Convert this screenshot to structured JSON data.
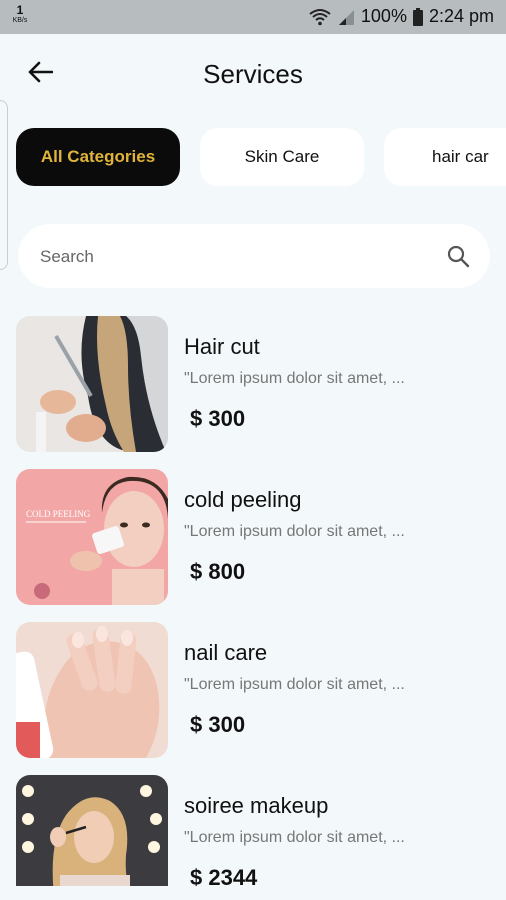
{
  "status_bar": {
    "kbs_value": "1",
    "kbs_unit": "KB/s",
    "battery": "100%",
    "time": "2:24 pm"
  },
  "header": {
    "title": "Services"
  },
  "categories": [
    {
      "label": "All Categories",
      "active": true
    },
    {
      "label": "Skin Care",
      "active": false
    },
    {
      "label": "hair car",
      "active": false
    }
  ],
  "search": {
    "placeholder": "Search"
  },
  "services": [
    {
      "title": "Hair cut",
      "description": "\"Lorem ipsum dolor sit amet, ...",
      "price": "$ 300"
    },
    {
      "title": "cold peeling",
      "description": "\"Lorem ipsum dolor sit amet, ...",
      "price": "$ 800",
      "image_text": "COLD PEELING"
    },
    {
      "title": "nail care",
      "description": "\"Lorem ipsum dolor sit amet, ...",
      "price": "$ 300"
    },
    {
      "title": "soiree makeup",
      "description": "\"Lorem ipsum dolor sit amet, ...",
      "price": "$ 2344"
    }
  ],
  "colors": {
    "background": "#f3f8fb",
    "active_chip_bg": "#0b0b0b",
    "active_chip_text": "#e0b43a",
    "status_bar": "#b7bcbf"
  },
  "icons": {
    "back": "arrow-left-icon",
    "search": "search-icon",
    "wifi": "wifi-icon",
    "signal": "signal-icon",
    "battery": "battery-icon"
  }
}
